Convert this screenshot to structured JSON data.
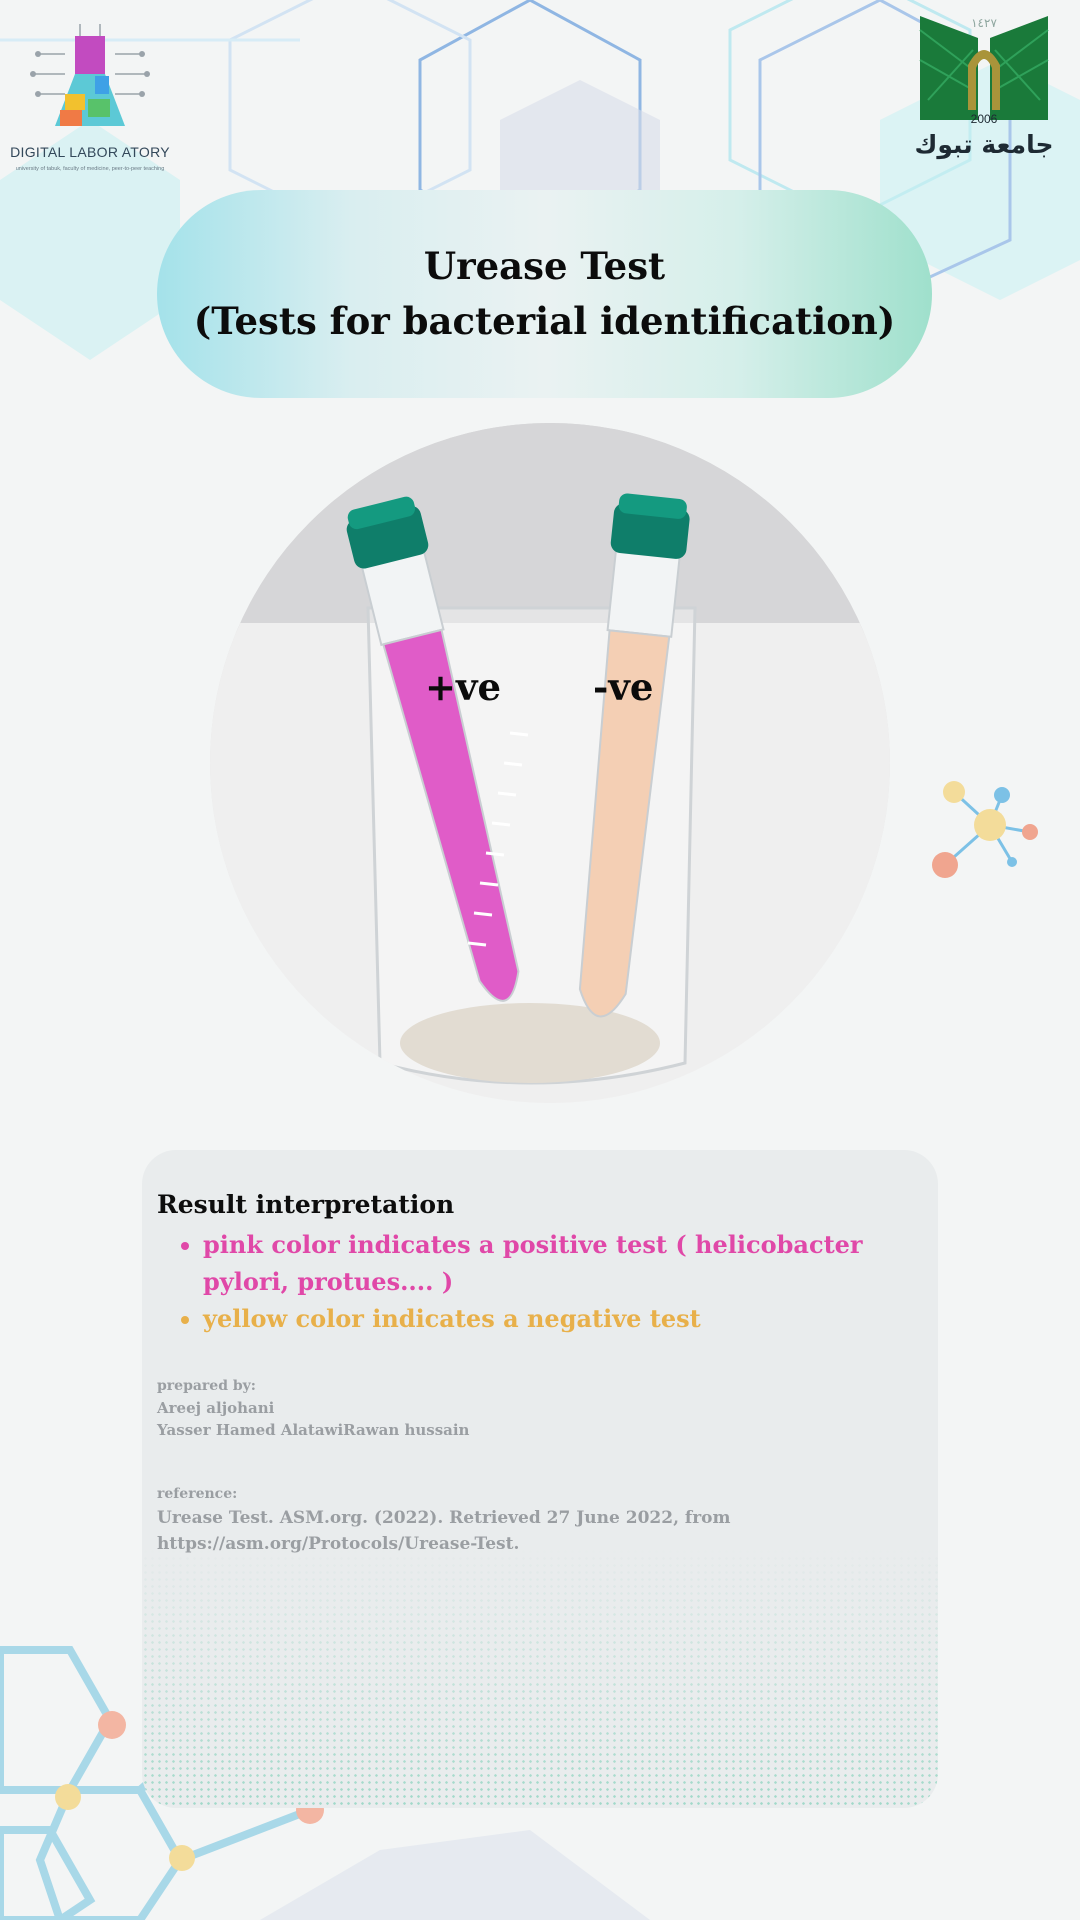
{
  "logos": {
    "left_caption": "DIGITAL LABOR  ATORY",
    "left_subcaption": "university of tabuk, faculty of medicine, peer-to-peer teaching",
    "right_year_top": "١٤٢٧",
    "right_year": "2006",
    "right_name": "جامعة تبوك"
  },
  "title": {
    "line1": "Urease Test",
    "line2": "(Tests for bacterial identification)"
  },
  "photo": {
    "positive_label": "+ve",
    "negative_label": "-ve",
    "tube_colors": {
      "positive": "#e05cc8",
      "negative": "#f4cfb4"
    },
    "cap_color": "#0f7e6a"
  },
  "result": {
    "heading": "Result interpretation",
    "items": [
      {
        "text": "pink color indicates a positive test ( helicobacter pylori, protues.... )",
        "color": "#e048a8"
      },
      {
        "text": "yellow color indicates a negative  test",
        "color": "#e8b04a"
      }
    ]
  },
  "prepared": {
    "label": "prepared by:",
    "line1": "Areej aljohani",
    "line2": "Yasser Hamed AlatawiRawan hussain"
  },
  "reference": {
    "label": "reference:",
    "line1": "Urease Test. ASM.org. (2022). Retrieved 27 June 2022, from",
    "line2": "https://asm.org/Protocols/Urease-Test."
  }
}
